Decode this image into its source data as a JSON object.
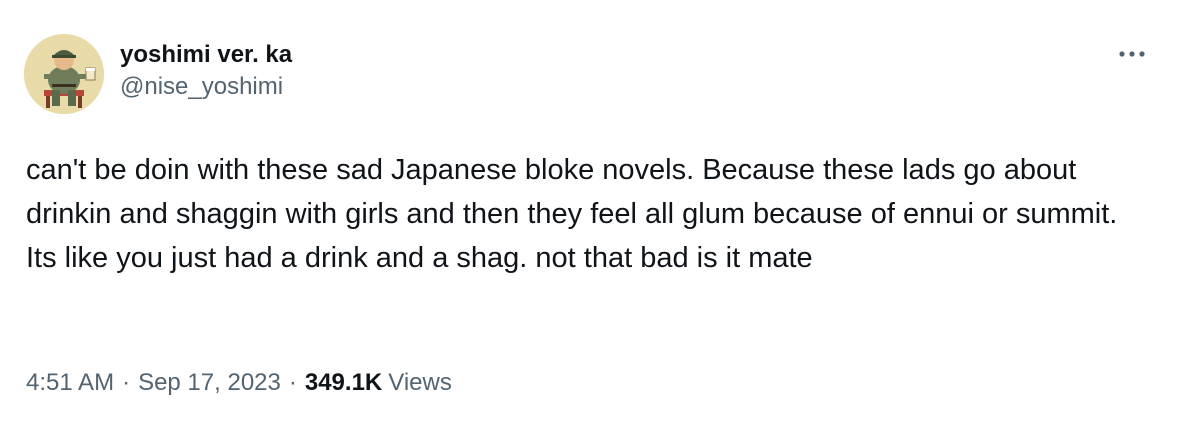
{
  "author": {
    "display_name": "yoshimi ver. ka",
    "handle": "@nise_yoshimi",
    "avatar_icon": "avatar-illustration"
  },
  "menu": {
    "icon": "more-horizontal-icon"
  },
  "tweet": {
    "text": "can't be doin with these sad Japanese bloke novels. Because these lads go about drinkin and shaggin with girls and then they feel all glum because of ennui or summit. Its like you just had a drink and a shag. not that bad is it mate"
  },
  "meta": {
    "time": "4:51 AM",
    "separator": "·",
    "date": "Sep 17, 2023",
    "views_count": "349.1K",
    "views_label": "Views"
  },
  "colors": {
    "text_primary": "#0f1419",
    "text_secondary": "#536471",
    "background": "#ffffff"
  }
}
